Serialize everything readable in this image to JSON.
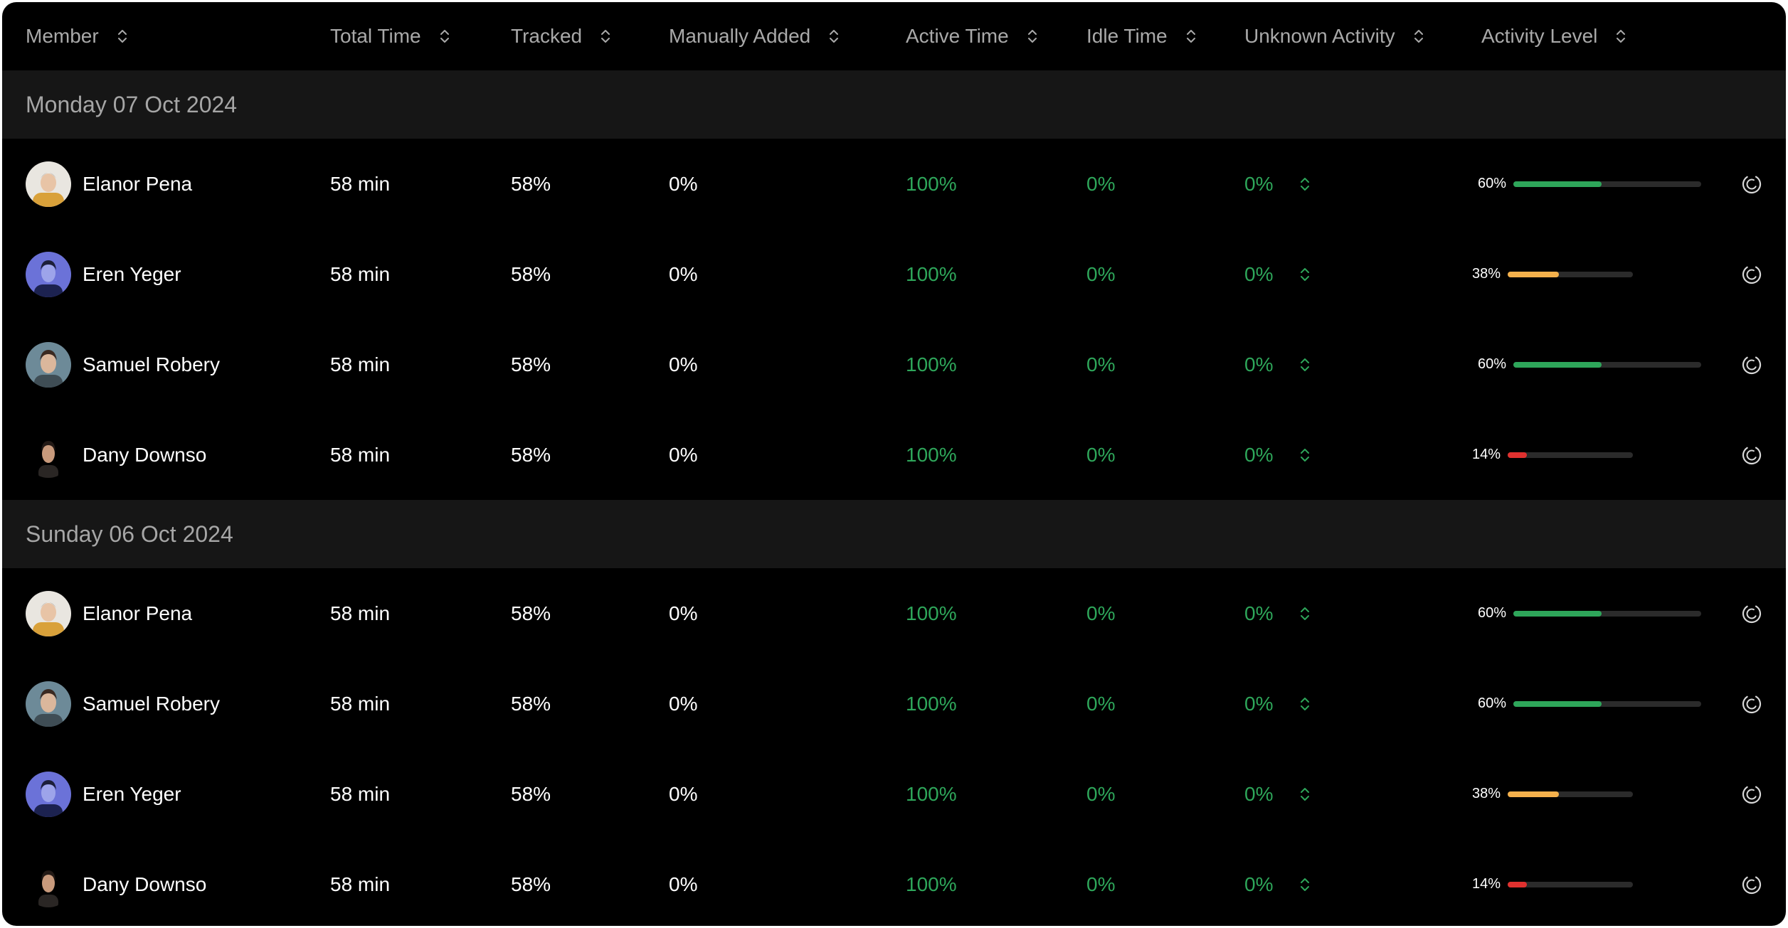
{
  "columns": [
    {
      "key": "member",
      "label": "Member"
    },
    {
      "key": "total_time",
      "label": "Total Time"
    },
    {
      "key": "tracked",
      "label": "Tracked"
    },
    {
      "key": "manually_added",
      "label": "Manually Added"
    },
    {
      "key": "active_time",
      "label": "Active Time"
    },
    {
      "key": "idle_time",
      "label": "Idle Time"
    },
    {
      "key": "unknown_activity",
      "label": "Unknown Activity"
    },
    {
      "key": "activity_level",
      "label": "Activity Level"
    }
  ],
  "colors": {
    "background": "#000000",
    "group_background": "#161616",
    "green_text": "#2ea65a",
    "level_high": "#2ea65a",
    "level_mid": "#f5b14c",
    "level_low": "#e0312f",
    "track": "#2b2b2b"
  },
  "icons": {
    "sort": "chevron-up-down-icon",
    "stepper": "chevron-up-down-icon",
    "row_action": "loading-spinner-icon"
  },
  "groups": [
    {
      "label": "Monday 07 Oct 2024",
      "rows": [
        {
          "member": "Elanor Pena",
          "avatar": "avatar-elanor",
          "total_time": "58 min",
          "tracked": "58%",
          "manually_added": "0%",
          "active_time": "100%",
          "idle_time": "0%",
          "unknown_activity": "0%",
          "activity_level_label": "60%",
          "activity_level": 0.6,
          "level_color": "#2ea65a"
        },
        {
          "member": "Eren Yeger",
          "avatar": "avatar-eren",
          "total_time": "58 min",
          "tracked": "58%",
          "manually_added": "0%",
          "active_time": "100%",
          "idle_time": "0%",
          "unknown_activity": "0%",
          "activity_level_label": "38%",
          "activity_level": 0.38,
          "level_color": "#f5b14c"
        },
        {
          "member": "Samuel Robery",
          "avatar": "avatar-samuel",
          "total_time": "58 min",
          "tracked": "58%",
          "manually_added": "0%",
          "active_time": "100%",
          "idle_time": "0%",
          "unknown_activity": "0%",
          "activity_level_label": "60%",
          "activity_level": 0.6,
          "level_color": "#2ea65a"
        },
        {
          "member": "Dany Downso",
          "avatar": "avatar-dany",
          "total_time": "58 min",
          "tracked": "58%",
          "manually_added": "0%",
          "active_time": "100%",
          "idle_time": "0%",
          "unknown_activity": "0%",
          "activity_level_label": "14%",
          "activity_level": 0.14,
          "level_color": "#e0312f"
        }
      ]
    },
    {
      "label": "Sunday 06 Oct 2024",
      "rows": [
        {
          "member": "Elanor Pena",
          "avatar": "avatar-elanor",
          "total_time": "58 min",
          "tracked": "58%",
          "manually_added": "0%",
          "active_time": "100%",
          "idle_time": "0%",
          "unknown_activity": "0%",
          "activity_level_label": "60%",
          "activity_level": 0.6,
          "level_color": "#2ea65a"
        },
        {
          "member": "Samuel Robery",
          "avatar": "avatar-samuel",
          "total_time": "58 min",
          "tracked": "58%",
          "manually_added": "0%",
          "active_time": "100%",
          "idle_time": "0%",
          "unknown_activity": "0%",
          "activity_level_label": "60%",
          "activity_level": 0.6,
          "level_color": "#2ea65a"
        },
        {
          "member": "Eren Yeger",
          "avatar": "avatar-eren",
          "total_time": "58 min",
          "tracked": "58%",
          "manually_added": "0%",
          "active_time": "100%",
          "idle_time": "0%",
          "unknown_activity": "0%",
          "activity_level_label": "38%",
          "activity_level": 0.38,
          "level_color": "#f5b14c"
        },
        {
          "member": "Dany Downso",
          "avatar": "avatar-dany",
          "total_time": "58 min",
          "tracked": "58%",
          "manually_added": "0%",
          "active_time": "100%",
          "idle_time": "0%",
          "unknown_activity": "0%",
          "activity_level_label": "14%",
          "activity_level": 0.14,
          "level_color": "#e0312f"
        }
      ]
    }
  ]
}
